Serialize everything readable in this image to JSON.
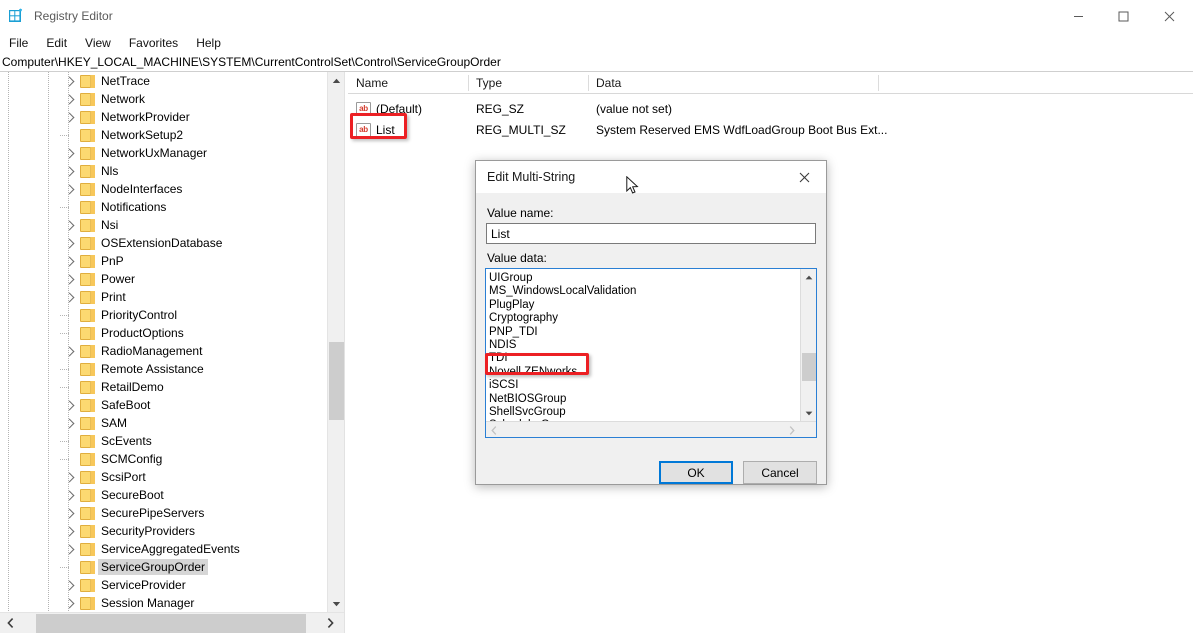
{
  "window": {
    "title": "Registry Editor",
    "icon": "registry-icon",
    "controls": {
      "minimize": "—",
      "maximize": "☐",
      "close": "✕"
    }
  },
  "menu": {
    "items": [
      "File",
      "Edit",
      "View",
      "Favorites",
      "Help"
    ]
  },
  "address": {
    "path": "Computer\\HKEY_LOCAL_MACHINE\\SYSTEM\\CurrentControlSet\\Control\\ServiceGroupOrder"
  },
  "tree": {
    "items": [
      {
        "label": "NetTrace",
        "expandable": true,
        "selected": false
      },
      {
        "label": "Network",
        "expandable": true,
        "selected": false
      },
      {
        "label": "NetworkProvider",
        "expandable": true,
        "selected": false
      },
      {
        "label": "NetworkSetup2",
        "expandable": false,
        "selected": false
      },
      {
        "label": "NetworkUxManager",
        "expandable": true,
        "selected": false
      },
      {
        "label": "Nls",
        "expandable": true,
        "selected": false
      },
      {
        "label": "NodeInterfaces",
        "expandable": true,
        "selected": false
      },
      {
        "label": "Notifications",
        "expandable": false,
        "selected": false
      },
      {
        "label": "Nsi",
        "expandable": true,
        "selected": false
      },
      {
        "label": "OSExtensionDatabase",
        "expandable": true,
        "selected": false
      },
      {
        "label": "PnP",
        "expandable": true,
        "selected": false
      },
      {
        "label": "Power",
        "expandable": true,
        "selected": false
      },
      {
        "label": "Print",
        "expandable": true,
        "selected": false
      },
      {
        "label": "PriorityControl",
        "expandable": false,
        "selected": false
      },
      {
        "label": "ProductOptions",
        "expandable": false,
        "selected": false
      },
      {
        "label": "RadioManagement",
        "expandable": true,
        "selected": false
      },
      {
        "label": "Remote Assistance",
        "expandable": false,
        "selected": false
      },
      {
        "label": "RetailDemo",
        "expandable": false,
        "selected": false
      },
      {
        "label": "SafeBoot",
        "expandable": true,
        "selected": false
      },
      {
        "label": "SAM",
        "expandable": true,
        "selected": false
      },
      {
        "label": "ScEvents",
        "expandable": false,
        "selected": false
      },
      {
        "label": "SCMConfig",
        "expandable": false,
        "selected": false
      },
      {
        "label": "ScsiPort",
        "expandable": true,
        "selected": false
      },
      {
        "label": "SecureBoot",
        "expandable": true,
        "selected": false
      },
      {
        "label": "SecurePipeServers",
        "expandable": true,
        "selected": false
      },
      {
        "label": "SecurityProviders",
        "expandable": true,
        "selected": false
      },
      {
        "label": "ServiceAggregatedEvents",
        "expandable": true,
        "selected": false
      },
      {
        "label": "ServiceGroupOrder",
        "expandable": false,
        "selected": true
      },
      {
        "label": "ServiceProvider",
        "expandable": true,
        "selected": false
      },
      {
        "label": "Session Manager",
        "expandable": true,
        "selected": false
      }
    ]
  },
  "values": {
    "columns": [
      "Name",
      "Type",
      "Data"
    ],
    "rows": [
      {
        "icon": "ab-string-icon",
        "name": "(Default)",
        "type": "REG_SZ",
        "data": "(value not set)",
        "highlighted": false
      },
      {
        "icon": "ab-string-icon",
        "name": "List",
        "type": "REG_MULTI_SZ",
        "data": "System Reserved EMS WdfLoadGroup Boot Bus Ext...",
        "highlighted": true
      }
    ]
  },
  "dialog": {
    "title": "Edit Multi-String",
    "close_label": "✕",
    "value_name_label": "Value name:",
    "value_name": "List",
    "value_data_label": "Value data:",
    "value_data_lines": [
      "UIGroup",
      "MS_WindowsLocalValidation",
      "PlugPlay",
      "Cryptography",
      "PNP_TDI",
      "NDIS",
      "TDI",
      "Novell ZENworks",
      "iSCSI",
      "NetBIOSGroup",
      "ShellSvcGroup",
      "SchedulerGroup"
    ],
    "highlighted_line": "Novell ZENworks",
    "ok_label": "OK",
    "cancel_label": "Cancel"
  },
  "annotations": {
    "accent_color": "#ec2024",
    "targets": [
      "list-value-row",
      "novell-zenworks-line"
    ]
  }
}
